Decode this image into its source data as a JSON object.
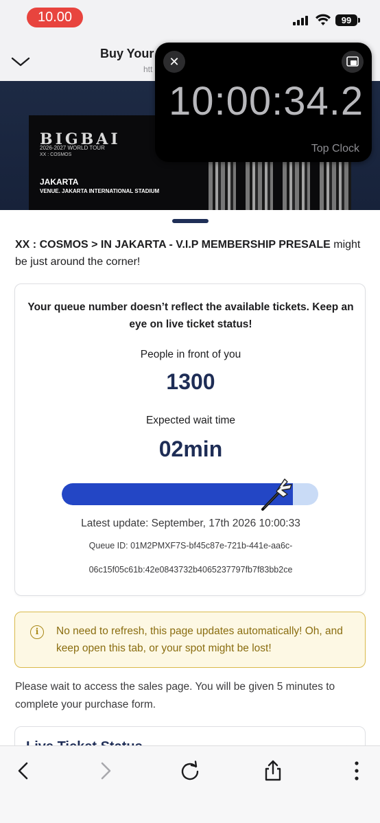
{
  "status_bar": {
    "time": "10.00",
    "battery": "99"
  },
  "header": {
    "title": "Buy Your I",
    "url": "htt"
  },
  "banner": {
    "logo_text": "BIGBAI",
    "tour_line": "2026-2027 WORLD TOUR",
    "subtitle": "XX : COSMOS",
    "city": "JAKARTA",
    "venue": "VENUE. JAKARTA INTERNATIONAL STADIUM"
  },
  "clock_overlay": {
    "time": "10:00:34.2",
    "label": "Top Clock"
  },
  "event": {
    "name": "XX : COSMOS > IN JAKARTA - V.I.P MEMBERSHIP PRESALE",
    "suffix": " might be just around the corner!"
  },
  "queue": {
    "notice": "Your queue number doesn’t reflect the available tickets. Keep an eye on live ticket status!",
    "people_label": "People in front of you",
    "people_value": "1300",
    "wait_label": "Expected wait time",
    "wait_value": "02min",
    "progress_fraction": 0.9,
    "last_update": "Latest update: September, 17th 2026 10:00:33",
    "queue_id_line1": "Queue ID: 01M2PMXF7S-bf45c87e-721b-441e-aa6c-",
    "queue_id_line2": "06c15f05c61b:42e0843732b4065237797fb7f83bb2ce"
  },
  "alert": {
    "icon": "info-icon",
    "text": "No need to refresh, this page updates automatically! Oh, and keep open this tab, or your spot might be lost!"
  },
  "wait_info": "Please wait to access the sales page. You will be given 5 minutes to complete your purchase form.",
  "live_status": {
    "title": "Live Ticket Status"
  },
  "toolbar": {
    "icons": [
      "back-icon",
      "forward-icon",
      "reload-icon",
      "share-icon",
      "more-icon"
    ]
  },
  "colors": {
    "primary": "#1e2d56",
    "progress": "#2346c5",
    "track": "#c9dbf6",
    "alert_bg": "#fdf8e4",
    "alert_text": "#8a6d10",
    "time_pill": "#e8443e"
  }
}
